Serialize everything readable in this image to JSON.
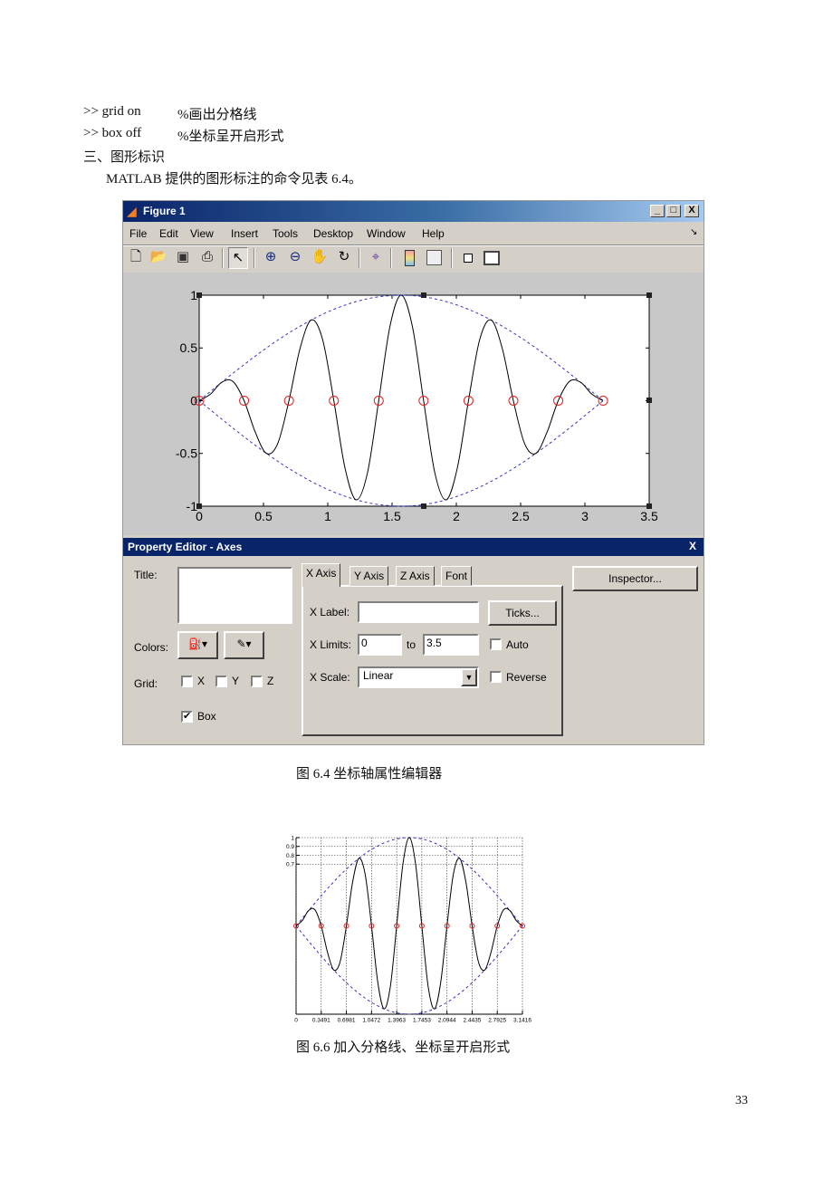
{
  "document": {
    "lines": [
      {
        "code": ">> grid on",
        "comment": "%画出分格线"
      },
      {
        "code": ">> box off",
        "comment": "%坐标呈开启形式"
      }
    ],
    "section_heading": "三、图形标识",
    "paragraph": "MATLAB 提供的图形标注的命令见表 6.4。",
    "caption_1": "图 6.4  坐标轴属性编辑器",
    "caption_2": "图 6.6  加入分格线、坐标呈开启形式",
    "page_number": "33"
  },
  "figure_window": {
    "title": "Figure 1",
    "controls": {
      "minimize": "_",
      "maximize": "□",
      "close": "X"
    },
    "menu": [
      "File",
      "Edit",
      "View",
      "Insert",
      "Tools",
      "Desktop",
      "Window",
      "Help"
    ],
    "toolbar": [
      "new-file-icon",
      "open-folder-icon",
      "save-icon",
      "print-icon",
      "pointer-icon",
      "zoom-in-icon",
      "zoom-out-icon",
      "pan-hand-icon",
      "rotate-3d-icon",
      "data-cursor-icon",
      "colorbar-icon",
      "legend-icon",
      "hide-plot-tools-icon",
      "show-plot-tools-icon"
    ],
    "property_editor": {
      "title": "Property Editor - Axes",
      "close": "X",
      "title_label": "Title:",
      "title_value": "",
      "colors_label": "Colors:",
      "grid_label": "Grid:",
      "grid": [
        {
          "label": "X",
          "checked": false
        },
        {
          "label": "Y",
          "checked": false
        },
        {
          "label": "Z",
          "checked": false
        }
      ],
      "box": {
        "label": "Box",
        "checked": true
      },
      "tabs": [
        "X Axis",
        "Y Axis",
        "Z Axis",
        "Font"
      ],
      "active_tab": "X Axis",
      "x_label_label": "X Label:",
      "x_label_value": "",
      "ticks_button": "Ticks...",
      "x_limits_label": "X Limits:",
      "x_min": "0",
      "to_label": "to",
      "x_max": "3.5",
      "auto": {
        "label": "Auto",
        "checked": false
      },
      "x_scale_label": "X Scale:",
      "x_scale_value": "Linear",
      "reverse": {
        "label": "Reverse",
        "checked": false
      },
      "inspector_button": "Inspector..."
    }
  },
  "chart_data": [
    {
      "type": "line",
      "xlim": [
        0,
        3.5
      ],
      "ylim": [
        -1,
        1
      ],
      "xticks": [
        "0",
        "0.5",
        "1",
        "1.5",
        "2",
        "2.5",
        "3",
        "3.5"
      ],
      "yticks": [
        "-1",
        "-0.5",
        "0",
        "0.5",
        "1"
      ],
      "grid": false,
      "box": true,
      "series": [
        {
          "style": "solid",
          "color": "#000000",
          "x_step_deg": 5,
          "y": [
            0,
            0.062,
            0.174,
            0.183,
            0,
            -0.299,
            -0.5,
            -0.406,
            0,
            0.5,
            0.766,
            0.579,
            0,
            -0.641,
            -0.94,
            -0.683,
            0,
            0.704,
            1,
            0.704,
            0,
            -0.683,
            -0.94,
            -0.641,
            0,
            0.579,
            0.766,
            0.5,
            0,
            -0.406,
            -0.5,
            -0.299,
            0,
            0.183,
            0.174,
            0.062,
            0
          ]
        },
        {
          "style": "dashed",
          "color": "#3333cc",
          "envelope": "upper",
          "y": [
            0,
            0.087,
            0.174,
            0.259,
            0.342,
            0.423,
            0.5,
            0.574,
            0.643,
            0.707,
            0.766,
            0.819,
            0.866,
            0.906,
            0.94,
            0.966,
            0.985,
            0.996,
            1,
            0.996,
            0.985,
            0.966,
            0.94,
            0.906,
            0.866,
            0.819,
            0.766,
            0.707,
            0.643,
            0.574,
            0.5,
            0.423,
            0.342,
            0.259,
            0.174,
            0.087,
            0
          ]
        },
        {
          "style": "dashed",
          "color": "#3333cc",
          "envelope": "lower"
        },
        {
          "style": "markers-circle",
          "color": "#e02020",
          "x": [
            0,
            0.3491,
            0.6981,
            1.0472,
            1.3963,
            1.7453,
            2.0944,
            2.4435,
            2.7925,
            3.1416
          ],
          "y": [
            0,
            0,
            0,
            0,
            0,
            0,
            0,
            0,
            0,
            0
          ]
        }
      ]
    },
    {
      "type": "line",
      "xlim": [
        0,
        3.1416
      ],
      "ylim": [
        -1,
        1
      ],
      "xticks": [
        "0",
        "0.3491",
        "0.6981",
        "1.0472",
        "1.3963",
        "1.7453",
        "2.0944",
        "2.4435",
        "2.7925",
        "3.1416"
      ],
      "yticks": [
        "0.7",
        "0.8",
        "0.9",
        "1"
      ],
      "grid": true,
      "box": false,
      "same_series_as_above": true
    }
  ]
}
